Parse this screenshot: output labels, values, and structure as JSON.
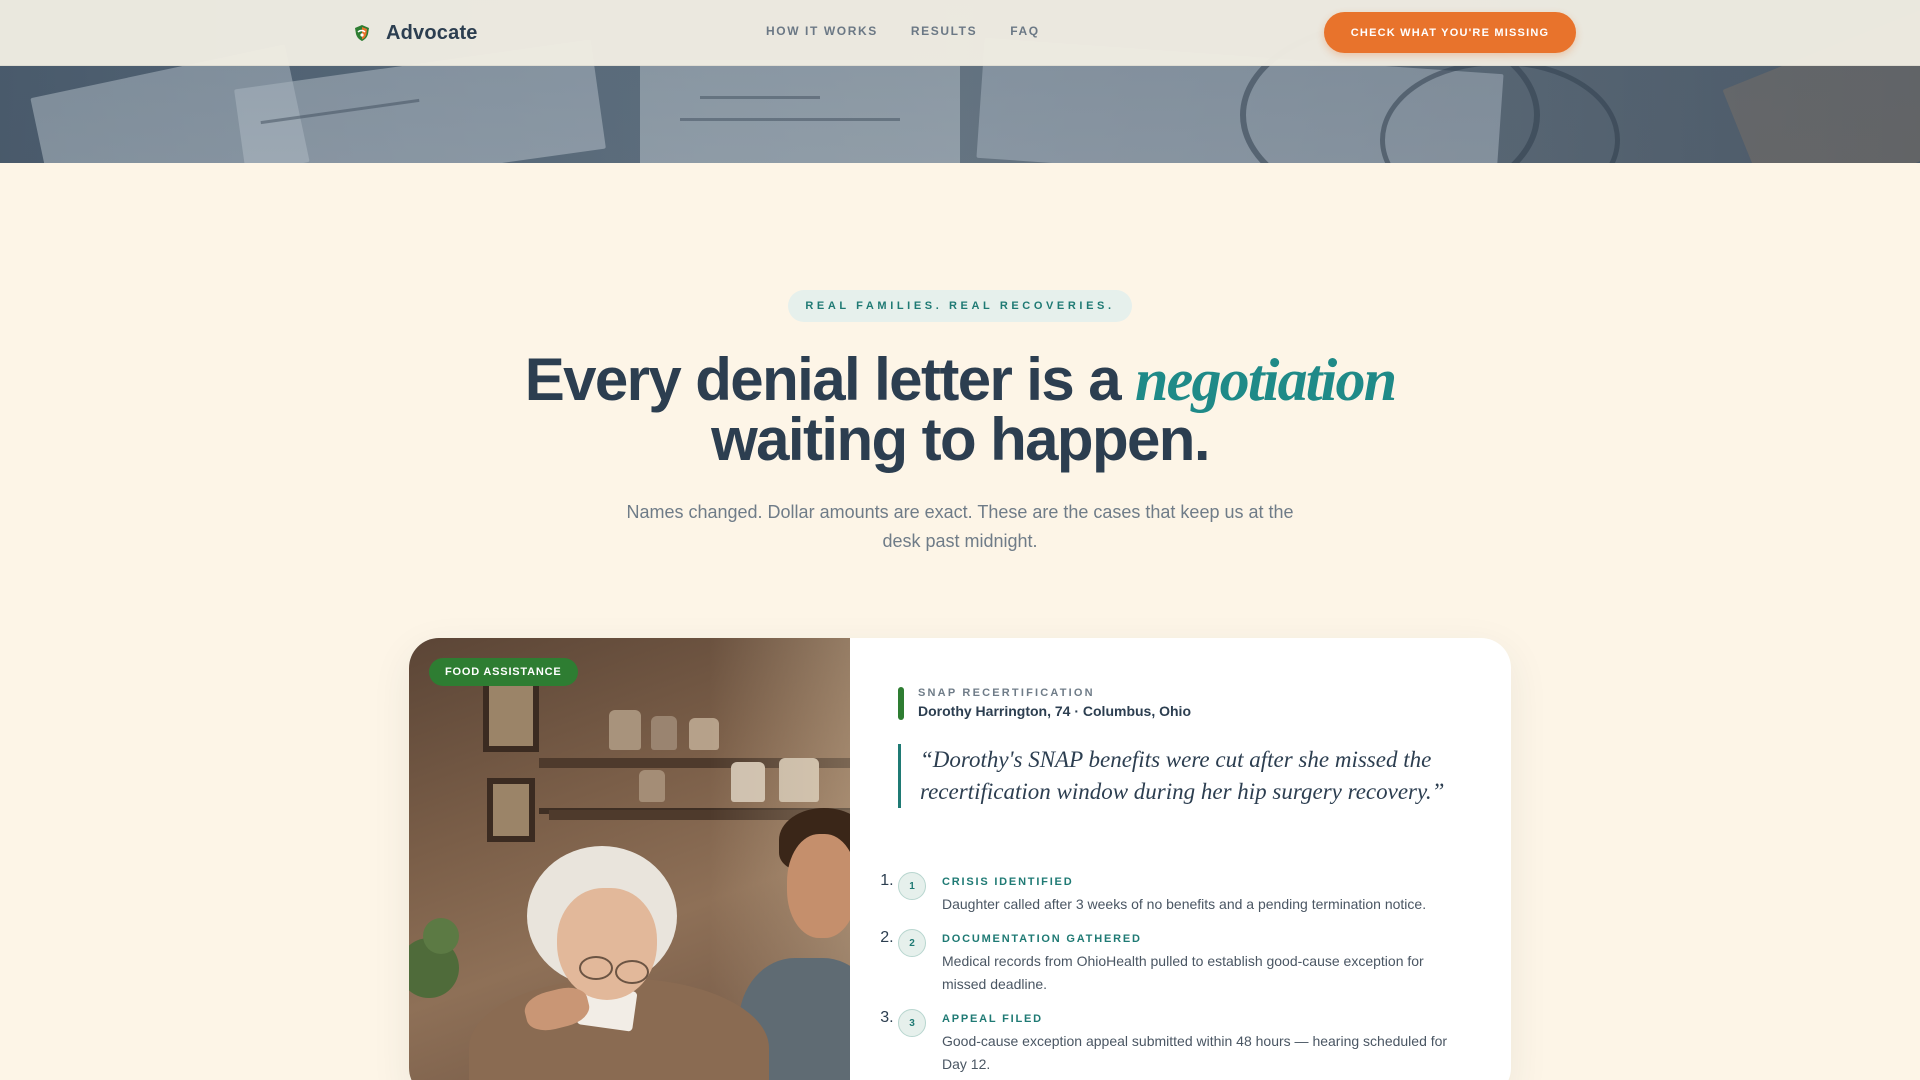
{
  "brand": {
    "name": "Advocate",
    "logo_icon": "shield-leaf-icon"
  },
  "nav": {
    "links": [
      "HOW IT WORKS",
      "RESULTS",
      "FAQ"
    ],
    "cta": "CHECK WHAT YOU'RE MISSING"
  },
  "section": {
    "eyebrow": "REAL FAMILIES. REAL RECOVERIES.",
    "headline_part1": "Every denial letter is a ",
    "headline_accent": "negotiation",
    "headline_part2": "waiting to happen.",
    "subhead": "Names changed. Dollar amounts are exact. These are the cases that keep us at the desk past midnight."
  },
  "case": {
    "category": "FOOD ASSISTANCE",
    "type": "SNAP RECERTIFICATION",
    "person": "Dorothy Harrington, 74 · Columbus, Ohio",
    "quote": "“Dorothy's SNAP benefits were cut after she missed the recertification window during her hip surgery recovery.”",
    "steps": [
      {
        "num": "1",
        "title": "CRISIS IDENTIFIED",
        "desc": "Daughter called after 3 weeks of no benefits and a pending termination notice."
      },
      {
        "num": "2",
        "title": "DOCUMENTATION GATHERED",
        "desc": "Medical records from OhioHealth pulled to establish good-cause exception for missed deadline."
      },
      {
        "num": "3",
        "title": "APPEAL FILED",
        "desc": "Good-cause exception appeal submitted within 48 hours — hearing scheduled for Day 12."
      }
    ]
  },
  "colors": {
    "accent_orange": "#e8732c",
    "teal": "#1f8a88",
    "green_badge": "#2e7d32",
    "navy_text": "#2c3e50",
    "page_bg": "#fdf5e7"
  }
}
